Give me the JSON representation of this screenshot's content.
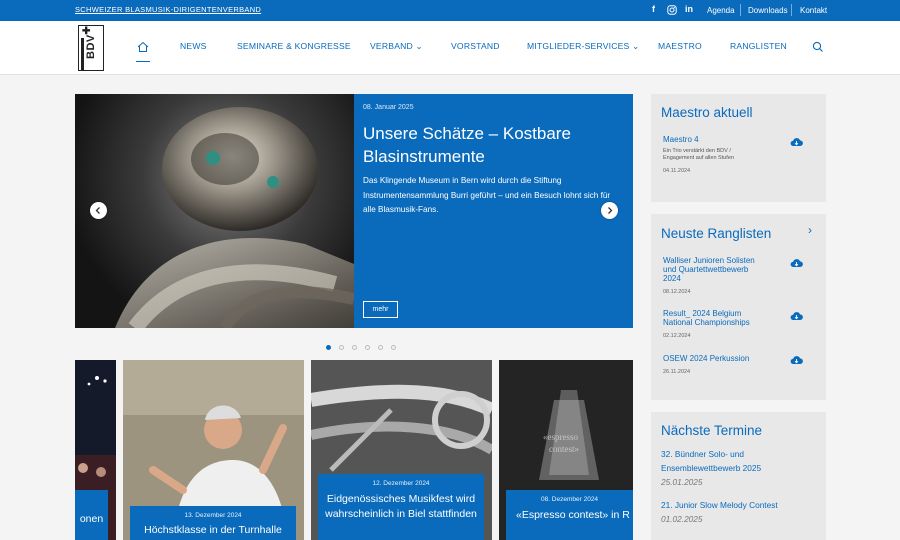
{
  "topbar": {
    "org_name": "SCHWEIZER BLASMUSIK-DIRIGENTENVERBAND",
    "social": {
      "facebook": "f",
      "instagram": "instagram-icon",
      "linkedin": "in"
    },
    "links": [
      "Agenda",
      "Downloads",
      "Kontakt"
    ]
  },
  "header": {
    "logo_text": "BDV",
    "nav": [
      "NEWS",
      "SEMINARE & KONGRESSE",
      "VERBAND",
      "VORSTAND",
      "MITGLIEDER-SERVICES",
      "MAESTRO",
      "RANGLISTEN"
    ],
    "dropdown_caret": "⌄"
  },
  "hero": {
    "date": "08. Januar 2025",
    "title": "Unsere Schätze – Kostbare Blasinstrumente",
    "body": "Das Klingende Museum in Bern wird durch die Stiftung Instrumentensammlung Burri geführt – und ein Besuch lohnt sich für alle Blasmusik-Fans.",
    "button": "mehr",
    "prev": "‹",
    "next": "›",
    "slide_count": 6,
    "active_slide": 1
  },
  "cards": [
    {
      "date": "",
      "title": "onen"
    },
    {
      "date": "13. Dezember 2024",
      "title": "Höchstklasse in der Turnhalle"
    },
    {
      "date": "12. Dezember 2024",
      "title": "Eidgenössisches Musikfest wird wahrscheinlich in Biel stattfinden"
    },
    {
      "date": "08. Dezember 2024",
      "title": "«Espresso contest» in R musste abgesagt wer"
    }
  ],
  "maestro": {
    "heading": "Maestro aktuell",
    "item": {
      "title": "Maestro 4",
      "subtitle": "Ein Trio verstärkt den BDV / Engagement auf allen Stufen",
      "date": "04.11.2024"
    }
  },
  "ranglisten": {
    "heading": "Neuste Ranglisten",
    "more": "›",
    "items": [
      {
        "title": "Walliser Junioren Solisten und Quartettwettbewerb 2024",
        "date": "08.12.2024"
      },
      {
        "title": "Result_ 2024 Belgium National Championships",
        "date": "02.12.2024"
      },
      {
        "title": "OSEW 2024 Perkussion",
        "date": "26.11.2024"
      }
    ]
  },
  "termine": {
    "heading": "Nächste Termine",
    "items": [
      {
        "title": "32. Bündner Solo- und Ensemblewettbewerb 2025",
        "date": "25.01.2025"
      },
      {
        "title": "21. Junior Slow Melody Contest",
        "date": "01.02.2025"
      }
    ]
  },
  "colors": {
    "brand_blue": "#0a6bbd",
    "panel_grey": "#e8e8e8",
    "page_bg": "#f4f4f4"
  }
}
